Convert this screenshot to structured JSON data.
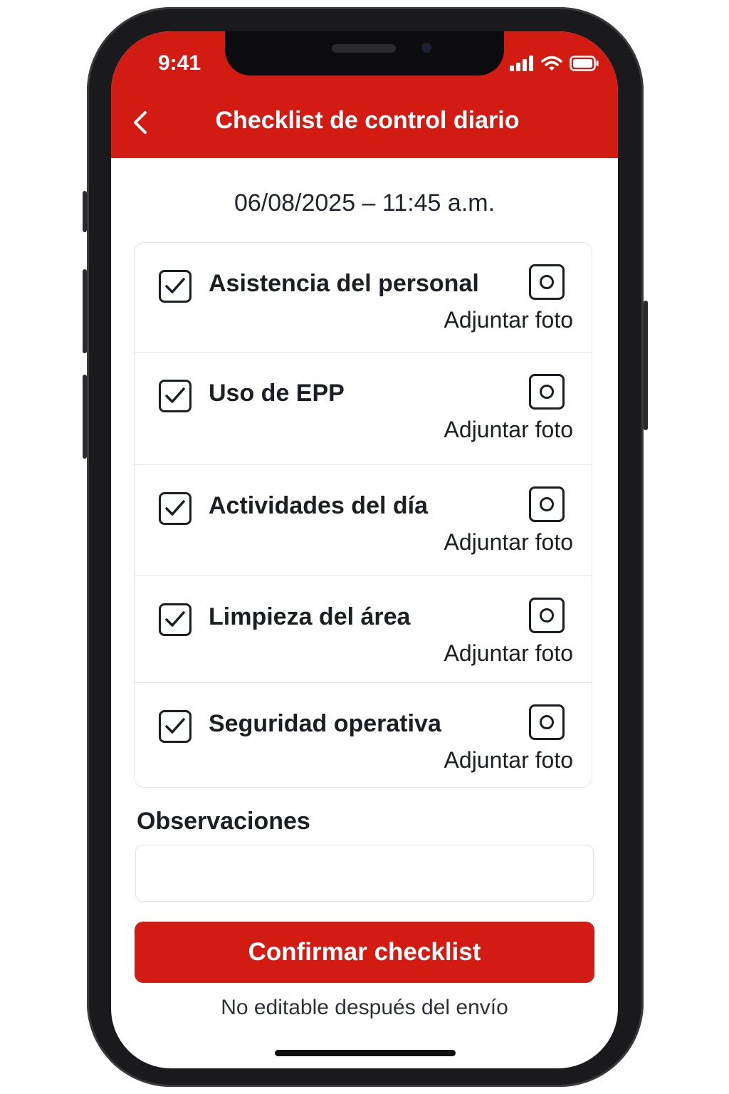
{
  "status_bar": {
    "time": "9:41",
    "icons": [
      "signal-icon",
      "wifi-icon",
      "battery-icon"
    ]
  },
  "header": {
    "title": "Checklist de control diario",
    "back_icon": "chevron-left-icon"
  },
  "date_time": "06/08/2025 – 11:45 a.m.",
  "checklist": {
    "items": [
      {
        "label": "Asistencia del personal",
        "checked": true,
        "attach_label": "Adjuntar foto"
      },
      {
        "label": "Uso de EPP",
        "checked": true,
        "attach_label": "Adjuntar foto"
      },
      {
        "label": "Actividades del día",
        "checked": true,
        "attach_label": "Adjuntar foto"
      },
      {
        "label": "Limpieza del área",
        "checked": true,
        "attach_label": "Adjuntar foto"
      },
      {
        "label": "Seguridad operativa",
        "checked": true,
        "attach_label": "Adjuntar foto"
      }
    ]
  },
  "observations": {
    "label": "Observaciones",
    "value": "",
    "placeholder": ""
  },
  "confirm_button": {
    "label": "Confirmar checklist"
  },
  "footnote": "No editable después del envío",
  "colors": {
    "accent": "#d21c13",
    "text": "#1b1e24",
    "border": "#e2e6ec"
  }
}
